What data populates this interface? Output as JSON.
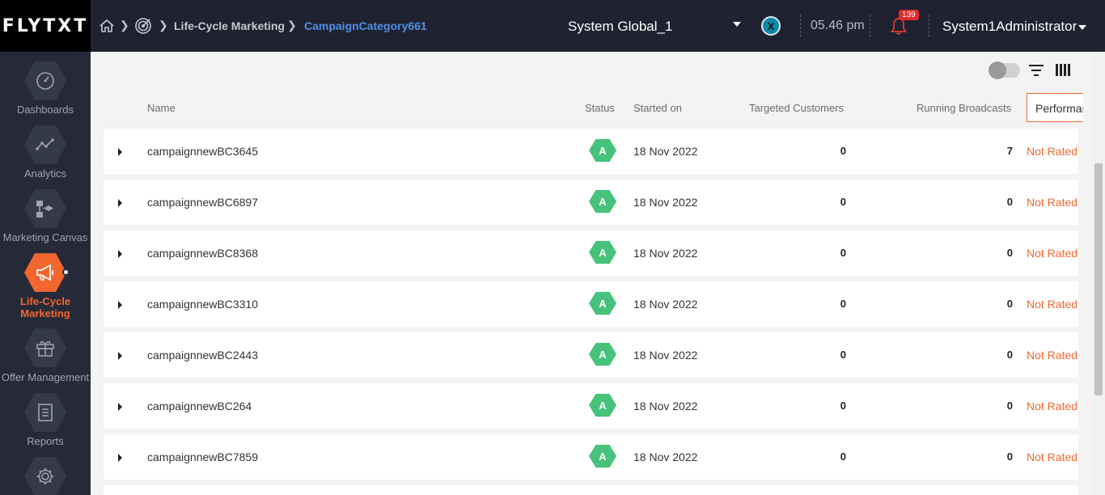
{
  "header": {
    "logo": "FLYTXT",
    "breadcrumb": [
      "Life-Cycle Marketing",
      "CampaignCategory661"
    ],
    "org": "System Global_1",
    "time": "05.46 pm",
    "notification_count": "139",
    "user": "System1Administrator"
  },
  "sidebar": {
    "items": [
      {
        "label": "Dashboards",
        "icon": "speedometer-icon"
      },
      {
        "label": "Analytics",
        "icon": "line-graph-icon"
      },
      {
        "label": "Marketing Canvas",
        "icon": "flow-canvas-icon"
      },
      {
        "label": "Life-Cycle Marketing",
        "icon": "megaphone-icon",
        "active": true
      },
      {
        "label": "Offer Management",
        "icon": "gift-icon"
      },
      {
        "label": "Reports",
        "icon": "document-icon"
      },
      {
        "label": "",
        "icon": "settings-gear-icon"
      }
    ]
  },
  "table": {
    "headers": {
      "name": "Name",
      "status": "Status",
      "started": "Started on",
      "targeted": "Targeted Customers",
      "running": "Running Broadcasts",
      "performance": "Performance"
    },
    "rows": [
      {
        "name": "campaignnewBC3645",
        "status": "A",
        "started": "18 Nov 2022",
        "targeted": "0",
        "running": "7",
        "rating": "Not Rated"
      },
      {
        "name": "campaignnewBC6897",
        "status": "A",
        "started": "18 Nov 2022",
        "targeted": "0",
        "running": "0",
        "rating": "Not Rated"
      },
      {
        "name": "campaignnewBC8368",
        "status": "A",
        "started": "18 Nov 2022",
        "targeted": "0",
        "running": "0",
        "rating": "Not Rated"
      },
      {
        "name": "campaignnewBC3310",
        "status": "A",
        "started": "18 Nov 2022",
        "targeted": "0",
        "running": "0",
        "rating": "Not Rated"
      },
      {
        "name": "campaignnewBC2443",
        "status": "A",
        "started": "18 Nov 2022",
        "targeted": "0",
        "running": "0",
        "rating": "Not Rated"
      },
      {
        "name": "campaignnewBC264",
        "status": "A",
        "started": "18 Nov 2022",
        "targeted": "0",
        "running": "0",
        "rating": "Not Rated"
      },
      {
        "name": "campaignnewBC7859",
        "status": "A",
        "started": "18 Nov 2022",
        "targeted": "0",
        "running": "0",
        "rating": "Not Rated"
      }
    ]
  },
  "colors": {
    "accent": "#f2672f",
    "header_bg": "#1f2230",
    "sidebar_bg": "#262a38",
    "status_active": "#47c27a",
    "breadcrumb_link": "#4f8fe6"
  }
}
